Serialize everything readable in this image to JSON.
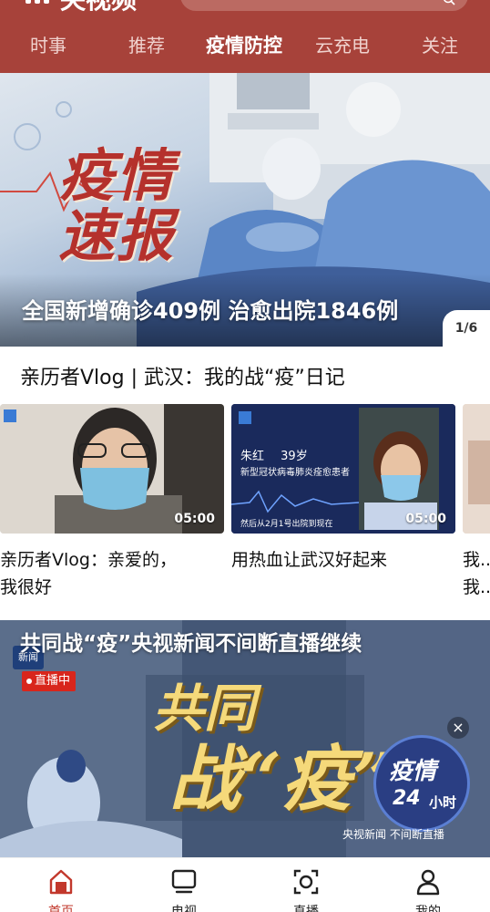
{
  "header": {
    "app_title": "央视频",
    "tabs": [
      {
        "label": "时事",
        "active": false
      },
      {
        "label": "推荐",
        "active": false
      },
      {
        "label": "疫情防控",
        "active": true
      },
      {
        "label": "云充电",
        "active": false
      },
      {
        "label": "关注",
        "active": false
      }
    ],
    "accent_color": "#a7423a"
  },
  "banner": {
    "stamp_line1": "疫情",
    "stamp_line2": "速报",
    "title": "全国新增确诊409例 治愈出院1846例",
    "page_indicator": "1/6"
  },
  "vlog_section": {
    "title": "亲历者Vlog | 武汉：我的战“疫”日记",
    "cards": [
      {
        "title_line1": "亲历者Vlog：亲爱的，",
        "title_line2": "我很好",
        "duration": "05:00"
      },
      {
        "title_line1": "用热血让武汉好起来",
        "title_line2": "",
        "duration": "05:00",
        "overlay_name": "朱红",
        "overlay_age": "39岁",
        "overlay_desc": "新型冠状病毒肺炎痊愈患者",
        "overlay_sub": "然后从2月1号出院到现在"
      },
      {
        "title_line1": "我...",
        "title_line2": "我...",
        "duration": ""
      }
    ]
  },
  "live_section": {
    "title": "共同战“疫”央视新闻不间断直播继续",
    "badge": "直播中",
    "big_word_1": "共同",
    "big_word_2": "战“疫”",
    "badge_line1": "疫情",
    "badge_line2": "24",
    "badge_line3": "小时",
    "caption": "央视新闻 不间断直播",
    "news_logo": "新闻",
    "close_symbol": "×"
  },
  "bottom_nav": [
    {
      "label": "首页",
      "icon": "home-icon",
      "active": true
    },
    {
      "label": "电视",
      "icon": "tv-icon",
      "active": false
    },
    {
      "label": "直播",
      "icon": "live-icon",
      "active": false
    },
    {
      "label": "我的",
      "icon": "user-icon",
      "active": false
    }
  ]
}
